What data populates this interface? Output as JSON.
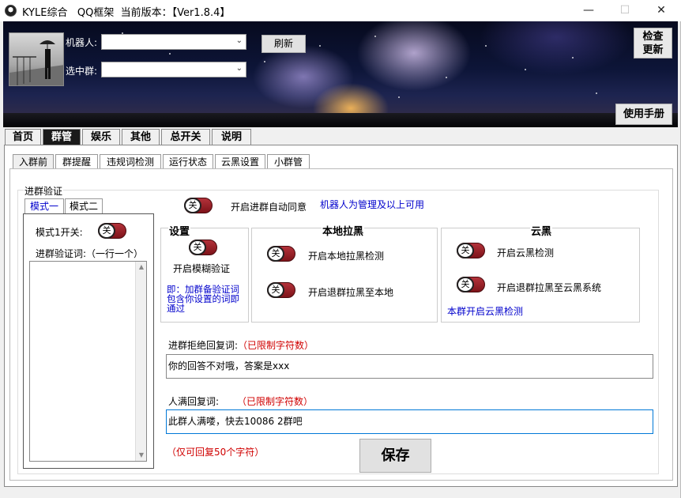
{
  "titlebar": {
    "title": "KYLE综合   QQ框架  当前版本：【Ver1.8.4】",
    "minimize": "—",
    "maximize": "☐",
    "close": "✕"
  },
  "header": {
    "robot_label": "机器人:",
    "robot_value": "",
    "group_label": "选中群:",
    "group_value": "",
    "refresh_button": "刷新",
    "check_update_line1": "检查",
    "check_update_line2": "更新",
    "manual_button": "使用手册"
  },
  "main_tabs": [
    {
      "label": "首页"
    },
    {
      "label": "群管"
    },
    {
      "label": "娱乐"
    },
    {
      "label": "其他"
    },
    {
      "label": "总开关"
    },
    {
      "label": "说明"
    }
  ],
  "sub_tabs": [
    {
      "label": "入群前"
    },
    {
      "label": "群提醒"
    },
    {
      "label": "违规词检测"
    },
    {
      "label": "运行状态"
    },
    {
      "label": "云黑设置"
    },
    {
      "label": "小群管"
    }
  ],
  "verify": {
    "group_title": "进群验证",
    "mode_tabs": [
      {
        "label": "模式一"
      },
      {
        "label": "模式二"
      }
    ],
    "mode1_switch_label": "模式1开关:",
    "verify_words_label": "进群验证词:（一行一个）",
    "verify_words_value": "",
    "toggle_off": "关"
  },
  "auto_agree": {
    "label": "开启进群自动同意",
    "note": "机器人为管理及以上可用"
  },
  "settings": {
    "title": "设置",
    "fuzzy_label": "开启模糊验证",
    "fuzzy_note": "即：加群备验证词包含你设置的词即通过"
  },
  "local_blacklist": {
    "title": "本地拉黑",
    "detect_label": "开启本地拉黑检测",
    "quit_label": "开启退群拉黑至本地"
  },
  "cloud_blacklist": {
    "title": "云黑",
    "detect_label": "开启云黑检测",
    "quit_label": "开启退群拉黑至云黑系统",
    "note": "本群开启云黑检测"
  },
  "reject_reply": {
    "label": "进群拒绝回复词:",
    "limit": "（已限制字符数）",
    "value": "你的回答不对哦，答案是xxx"
  },
  "full_reply": {
    "label": "人满回复词:",
    "limit": "（已限制字符数）",
    "value": "此群人满喽，快去10086 2群吧"
  },
  "footer": {
    "limit_note": "（仅可回复50个字符）",
    "save_button": "保存"
  }
}
